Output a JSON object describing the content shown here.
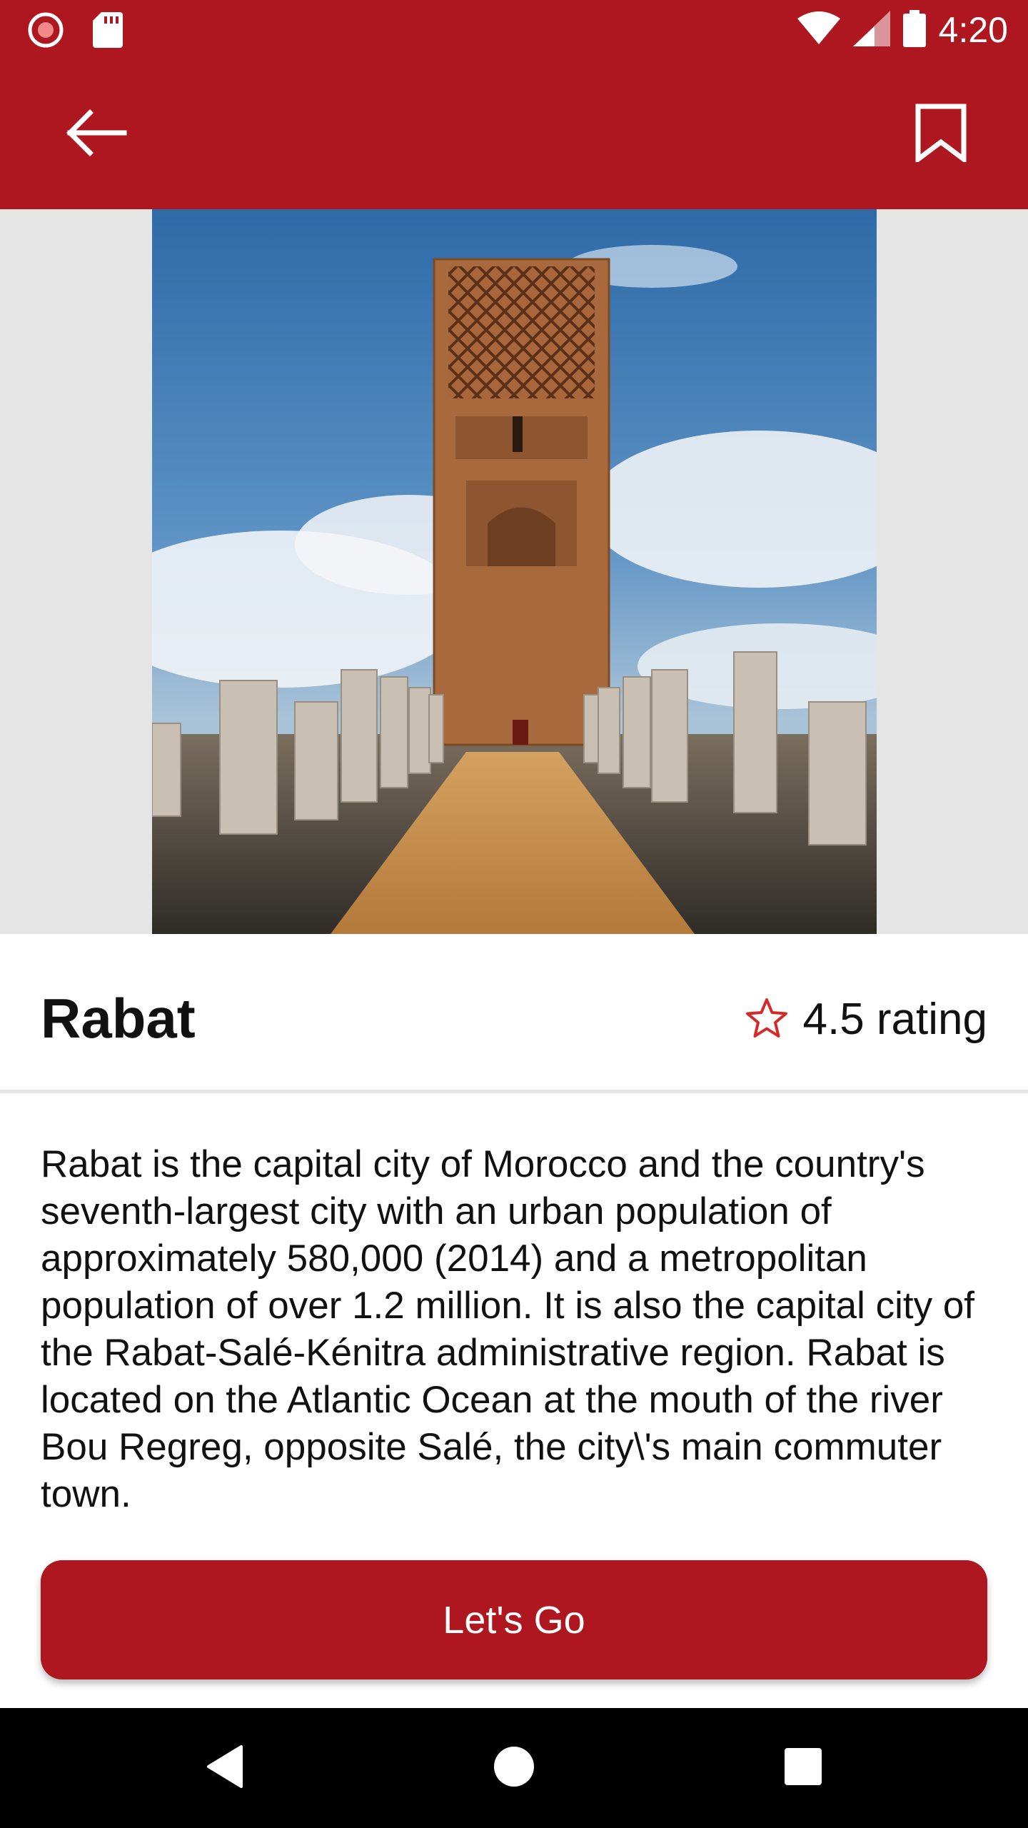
{
  "status_bar": {
    "time": "4:20",
    "icons": [
      "record-icon",
      "sd-card-icon",
      "wifi-icon",
      "signal-icon",
      "battery-icon"
    ]
  },
  "app_bar": {
    "back_icon": "arrow-left-icon",
    "bookmark_icon": "bookmark-icon",
    "color": "#ae1620"
  },
  "hero": {
    "image": "hassan-tower-photo"
  },
  "place": {
    "title": "Rabat",
    "rating_icon": "star-outline-icon",
    "rating_text": "4.5 rating",
    "description": "Rabat is the capital city of Morocco and the country's seventh-largest city with an urban population of approximately 580,000 (2014) and a metropolitan population of over 1.2 million. It is also the capital city of the Rabat-Salé-Kénitra administrative region. Rabat is located on the Atlantic Ocean at the mouth of the river Bou Regreg, opposite Salé, the city\\'s main commuter town."
  },
  "cta": {
    "label": "Let's Go"
  },
  "nav_bar": {
    "icons": [
      "nav-back-icon",
      "nav-home-icon",
      "nav-recents-icon"
    ]
  }
}
